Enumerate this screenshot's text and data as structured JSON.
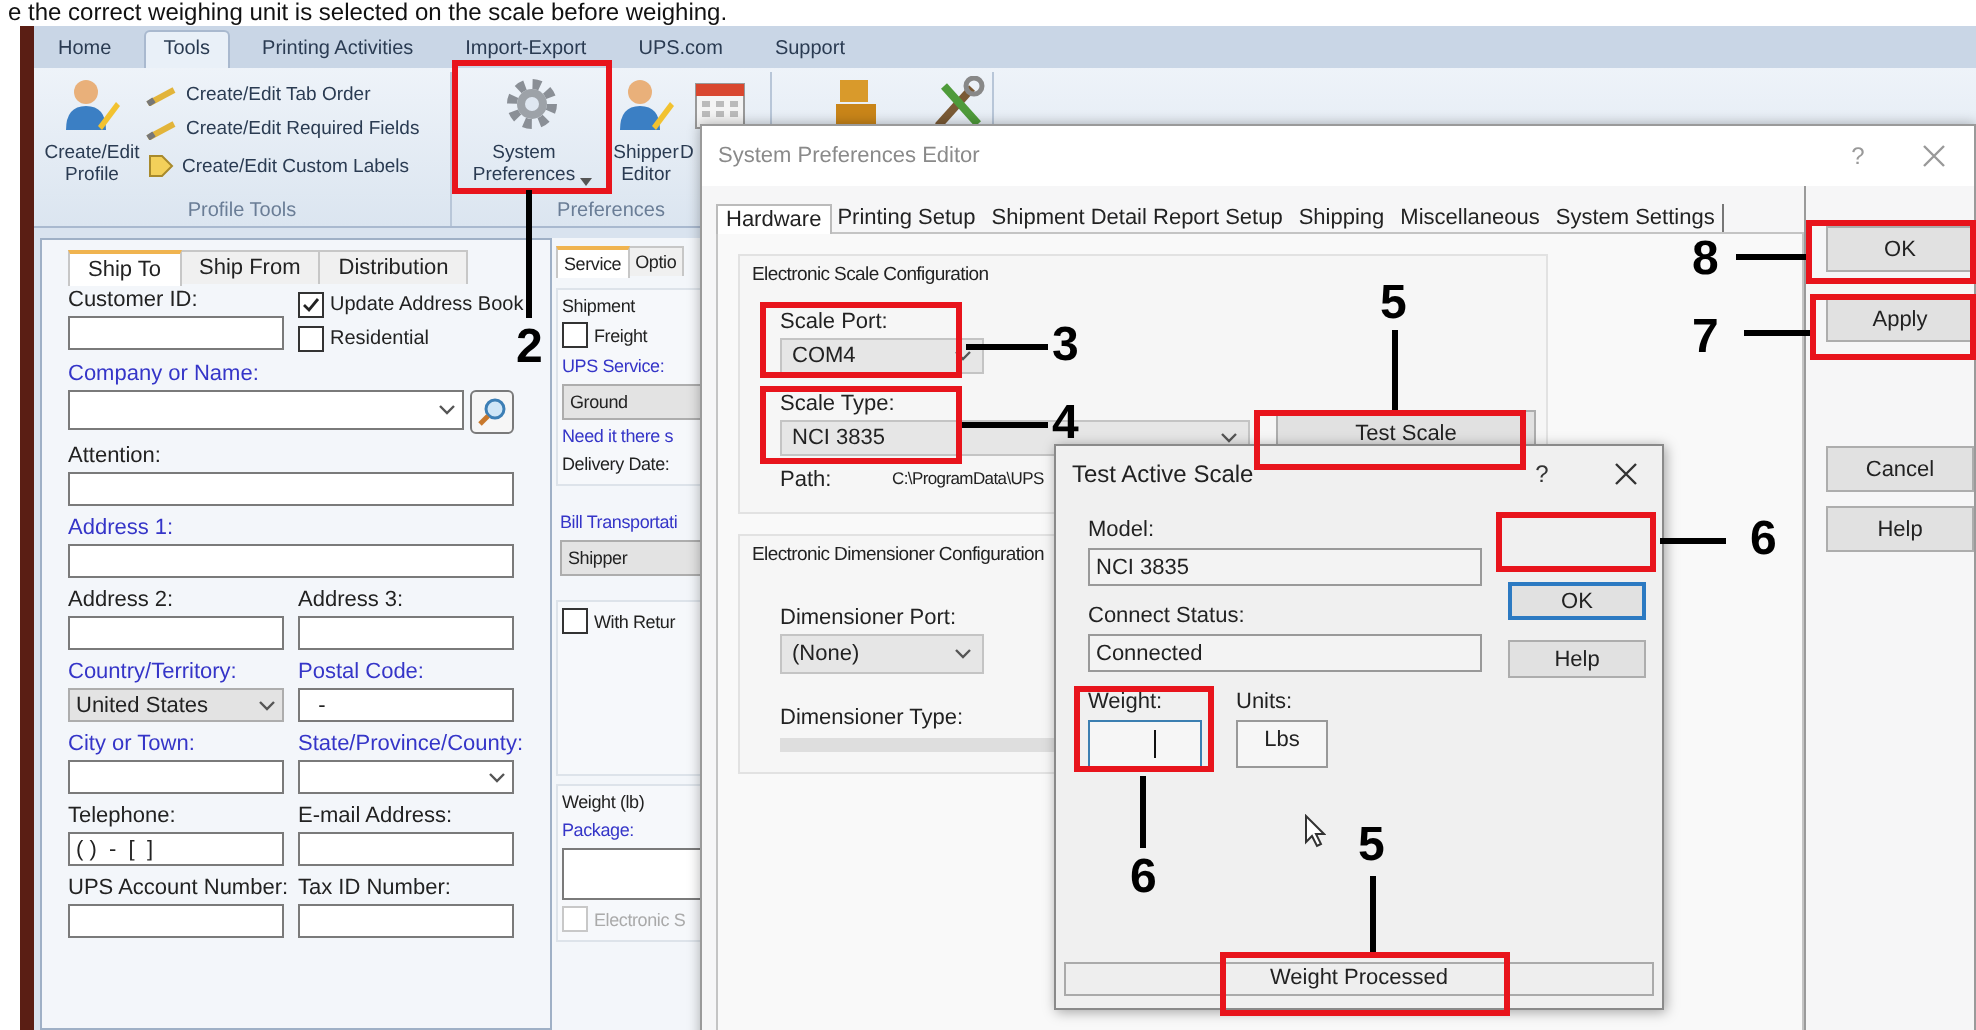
{
  "caption": "e the correct weighing unit is selected on the scale before weighing.",
  "app": {
    "tabs": [
      {
        "label": "Home",
        "selected": false
      },
      {
        "label": "Tools",
        "selected": true
      },
      {
        "label": "Printing Activities",
        "selected": false
      },
      {
        "label": "Import-Export",
        "selected": false
      },
      {
        "label": "UPS.com",
        "selected": false
      },
      {
        "label": "Support",
        "selected": false
      }
    ],
    "ribbon_groups": [
      {
        "label": "Profile Tools",
        "buttons": [
          {
            "label": "Create/Edit Profile",
            "kind": "profile",
            "dropdown": false
          }
        ],
        "items": [
          {
            "label": "Create/Edit Tab Order",
            "kind": "pencil"
          },
          {
            "label": "Create/Edit Required Fields",
            "kind": "pencil"
          },
          {
            "label": "Create/Edit Custom Labels",
            "kind": "label"
          }
        ]
      },
      {
        "label": "Preferences",
        "buttons": [
          {
            "label": "System Preferences",
            "kind": "gear",
            "dropdown": true
          },
          {
            "label": "Shipper Editor",
            "kind": "profile",
            "dropdown": false
          },
          {
            "label": "D",
            "kind": "calendar",
            "dropdown": false
          }
        ]
      },
      {
        "buttons": [
          {
            "kind": "boxes",
            "dropdown": false
          },
          {
            "kind": "tools",
            "dropdown": false
          }
        ]
      }
    ]
  },
  "ship_to": {
    "tabs": [
      {
        "label": "Ship To",
        "selected": true
      },
      {
        "label": "Ship From",
        "selected": false
      },
      {
        "label": "Distribution",
        "selected": false
      }
    ],
    "fields": [
      {
        "kind": "text",
        "label": "Customer ID:",
        "required": false
      },
      {
        "kind": "checks",
        "items": [
          {
            "label": "Update Address Book",
            "checked": true
          },
          {
            "label": "Residential",
            "checked": false
          }
        ]
      },
      {
        "kind": "combo_search",
        "label": "Company or Name:",
        "required": true
      },
      {
        "kind": "text_wide",
        "label": "Attention:",
        "required": false
      },
      {
        "kind": "text_wide",
        "label": "Address 1:",
        "required": true
      },
      {
        "kind": "text",
        "label": "Address 2:",
        "required": false
      },
      {
        "kind": "text",
        "label": "Address 3:",
        "required": false
      },
      {
        "kind": "dropdown",
        "label": "Country/Territory:",
        "required": true,
        "value": "United States"
      },
      {
        "kind": "text",
        "label": "Postal Code:",
        "required": true,
        "value": "  -"
      },
      {
        "kind": "text",
        "label": "City or Town:",
        "required": true
      },
      {
        "kind": "combo",
        "label": "State/Province/County:",
        "required": true
      },
      {
        "kind": "text",
        "label": "Telephone:",
        "required": false,
        "value": "( )  -  [  ]"
      },
      {
        "kind": "text",
        "label": "E-mail Address:",
        "required": false
      },
      {
        "kind": "text",
        "label": "UPS Account Number:",
        "required": false
      },
      {
        "kind": "text",
        "label": "Tax ID Number:",
        "required": false
      }
    ]
  },
  "service": {
    "tabs": [
      {
        "label": "Service",
        "selected": true
      },
      {
        "label": "Optio",
        "selected": false
      }
    ],
    "sections": [
      {
        "title": "Shipment",
        "items": [
          {
            "kind": "checkbox",
            "label": "Freight",
            "checked": false,
            "disabled": false
          },
          {
            "kind": "label",
            "text": "UPS Service:",
            "required": true
          },
          {
            "kind": "dropdown",
            "value": "Ground"
          },
          {
            "kind": "link",
            "text": "Need it there s"
          },
          {
            "kind": "label",
            "text": "Delivery Date:",
            "required": false
          }
        ]
      },
      {
        "items": [
          {
            "kind": "label",
            "text": "Bill Transportati",
            "required": true
          },
          {
            "kind": "dropdown",
            "value": "Shipper"
          }
        ]
      },
      {
        "items": [
          {
            "kind": "checkbox",
            "label": "With Retur",
            "checked": false,
            "disabled": false
          }
        ]
      },
      {
        "title": "Weight (lb)",
        "items": [
          {
            "kind": "label",
            "text": "Package:",
            "required": true
          },
          {
            "kind": "field"
          },
          {
            "kind": "checkbox",
            "label": "Electronic S",
            "checked": false,
            "disabled": true
          }
        ]
      }
    ]
  },
  "preferences_dialog": {
    "title": "System Preferences Editor",
    "help": "?",
    "tabs": [
      {
        "label": "Hardware",
        "selected": true
      },
      {
        "label": "Printing Setup",
        "selected": false
      },
      {
        "label": "Shipment Detail Report Setup",
        "selected": false
      },
      {
        "label": "Shipping",
        "selected": false
      },
      {
        "label": "Miscellaneous",
        "selected": false
      },
      {
        "label": "System Settings",
        "selected": false
      }
    ],
    "scale": {
      "title": "Electronic Scale Configuration",
      "port_label": "Scale Port:",
      "port": "COM4",
      "type_label": "Scale Type:",
      "type": "NCI 3835",
      "test_button": "Test Scale",
      "path_label": "Path:",
      "path": "C:\\ProgramData\\UPS"
    },
    "dimensioner": {
      "title": "Electronic Dimensioner Configuration",
      "port_label": "Dimensioner Port:",
      "port": "(None)",
      "type_label": "Dimensioner Type:"
    },
    "buttons": [
      "OK",
      "Apply",
      "Cancel",
      "Help"
    ]
  },
  "test_dialog": {
    "title": "Test Active Scale",
    "help": "?",
    "model_label": "Model:",
    "model": "NCI 3835",
    "status_label": "Connect Status:",
    "status": "Connected",
    "weight_label": "Weight:",
    "units_label": "Units:",
    "units": "Lbs",
    "buttons": [
      "OK",
      "Help"
    ],
    "status_bar": "Weight Processed"
  },
  "callouts": [
    "8",
    "5",
    "2",
    "3",
    "7",
    "4",
    "6",
    "6",
    "5"
  ]
}
